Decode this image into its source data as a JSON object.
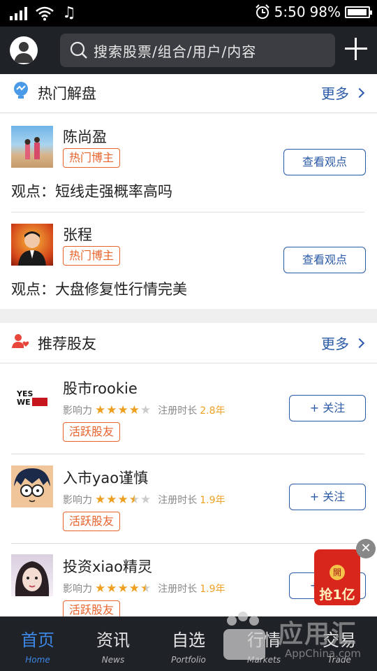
{
  "status_bar": {
    "time": "5:50",
    "battery": "98%"
  },
  "header": {
    "search_placeholder": "搜索股票/组合/用户/内容"
  },
  "hot_section": {
    "title": "热门解盘",
    "more": "更多",
    "items": [
      {
        "name": "陈尚盈",
        "badge": "热门博主",
        "button": "查看观点",
        "opinion": "观点：短线走强概率高吗"
      },
      {
        "name": "张程",
        "badge": "热门博主",
        "button": "查看观点",
        "opinion": "观点：大盘修复性行情完美"
      }
    ]
  },
  "friends_section": {
    "title": "推荐股友",
    "more": "更多",
    "influence_label": "影响力",
    "reg_label": "注册时长",
    "items": [
      {
        "name": "股市rookie",
        "rating": 4,
        "years": "2.8年",
        "badge": "活跃股友",
        "button": "+ 关注"
      },
      {
        "name": "入市yao谨慎",
        "rating": 3.5,
        "years": "1.9年",
        "badge": "活跃股友",
        "button": "+ 关注"
      },
      {
        "name": "投资xiao精灵",
        "rating": 4.5,
        "years": "1.9年",
        "badge": "活跃股友",
        "button": "+ 关注"
      }
    ]
  },
  "promo": {
    "seal": "開",
    "text": "抢1亿"
  },
  "tabs": [
    {
      "cn": "首页",
      "en": "Home",
      "active": true
    },
    {
      "cn": "资讯",
      "en": "News",
      "active": false
    },
    {
      "cn": "自选",
      "en": "Portfolio",
      "active": false
    },
    {
      "cn": "行情",
      "en": "Markets",
      "active": false
    },
    {
      "cn": "交易",
      "en": "Trade",
      "active": false
    }
  ],
  "watermark": {
    "cn": "应用汇",
    "en": "AppChina.com"
  },
  "colors": {
    "accent": "#2a5aa6",
    "badge": "#e8632b",
    "tab_active": "#3d87e6",
    "star": "#f0a020"
  }
}
